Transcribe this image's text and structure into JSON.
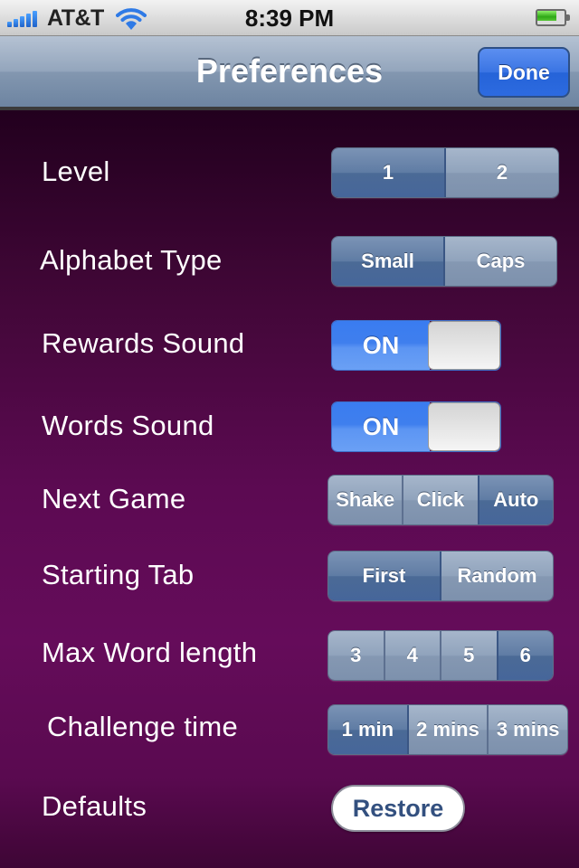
{
  "status_bar": {
    "carrier": "AT&T",
    "time": "8:39 PM",
    "signal_bars": 5,
    "battery_level_fraction": 0.75,
    "icons": [
      "signal-icon",
      "wifi-icon",
      "battery-icon"
    ]
  },
  "nav": {
    "title": "Preferences",
    "done_label": "Done",
    "accent_color": "#2d6be0"
  },
  "settings": {
    "level": {
      "label": "Level",
      "options": [
        "1",
        "2"
      ],
      "selected": "1"
    },
    "alphabet_type": {
      "label": "Alphabet Type",
      "options": [
        "Small",
        "Caps"
      ],
      "selected": "Small"
    },
    "rewards_sound": {
      "label": "Rewards Sound",
      "state": "ON"
    },
    "words_sound": {
      "label": "Words Sound",
      "state": "ON"
    },
    "next_game": {
      "label": "Next Game",
      "options": [
        "Shake",
        "Click",
        "Auto"
      ],
      "selected": "Auto"
    },
    "starting_tab": {
      "label": "Starting Tab",
      "options": [
        "First",
        "Random"
      ],
      "selected": "First"
    },
    "max_word_length": {
      "label": "Max Word length",
      "options": [
        "3",
        "4",
        "5",
        "6"
      ],
      "selected": "6"
    },
    "challenge_time": {
      "label": "Challenge time",
      "options": [
        "1 min",
        "2 mins",
        "3 mins"
      ],
      "selected": "1 min"
    },
    "defaults": {
      "label": "Defaults",
      "button_label": "Restore"
    }
  },
  "colors": {
    "background_top": "#22001e",
    "background_mid": "#650c5a",
    "segment_selected": "#4b6a96",
    "segment_unselected": "#8598b2",
    "toggle_on": "#3f7fee",
    "restore_text": "#33507f"
  }
}
